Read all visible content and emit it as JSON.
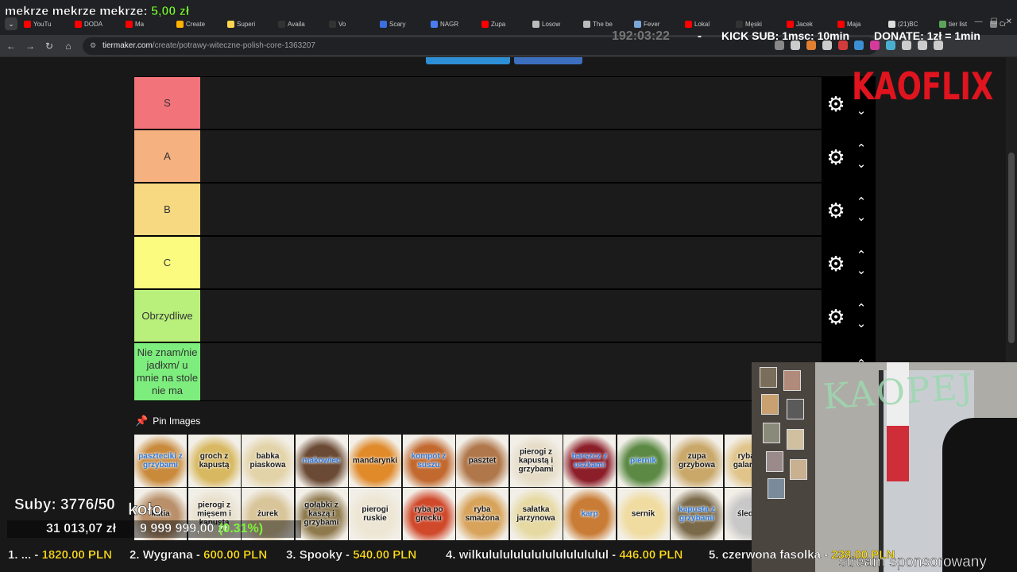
{
  "browser": {
    "tabs": [
      {
        "label": "YouTu",
        "color": "#ff0000"
      },
      {
        "label": "DODA",
        "color": "#ff0000"
      },
      {
        "label": "Ma",
        "color": "#ff0000"
      },
      {
        "label": "Create",
        "color": "#ffb300"
      },
      {
        "label": "Superi",
        "color": "#ffd54f"
      },
      {
        "label": "Availa",
        "color": "#333333"
      },
      {
        "label": "Vo",
        "color": "#333333"
      },
      {
        "label": "Scary",
        "color": "#3b6fe0"
      },
      {
        "label": "NAGR",
        "color": "#4a7cf0"
      },
      {
        "label": "Zupa",
        "color": "#ff0000"
      },
      {
        "label": "Losow",
        "color": "#bbbbbb"
      },
      {
        "label": "The be",
        "color": "#bbbbbb"
      },
      {
        "label": "Fever",
        "color": "#7aa7d9"
      },
      {
        "label": "Lokal",
        "color": "#ff0000"
      },
      {
        "label": "Męski",
        "color": "#333333"
      },
      {
        "label": "Jacek",
        "color": "#ff0000"
      },
      {
        "label": "Maja",
        "color": "#ff0000"
      },
      {
        "label": "(21)BC",
        "color": "#dddddd"
      },
      {
        "label": "tier list",
        "color": "#5aa55a"
      },
      {
        "label": "Cr",
        "color": "#888888"
      }
    ],
    "url_domain": "tiermaker.com",
    "url_path": "/create/potrawy-witeczne-polish-core-1363207",
    "extension_colors": [
      "#888888",
      "#cccccc",
      "#e08030",
      "#cccccc",
      "#d23b3b",
      "#3b8fd2",
      "#d23b9b",
      "#4ab0d0",
      "#cccccc",
      "#cccccc",
      "#cccccc"
    ]
  },
  "tiers": [
    {
      "label": "S",
      "color": "#f2737a"
    },
    {
      "label": "A",
      "color": "#f5b17f"
    },
    {
      "label": "B",
      "color": "#f6d981"
    },
    {
      "label": "C",
      "color": "#fbfb80"
    },
    {
      "label": "Obrzydliwe",
      "color": "#b9f07b"
    },
    {
      "label": "Nie znam/nie jadłxm/ u mnie na stole nie ma",
      "color": "#7dee7d"
    }
  ],
  "pin_images_label": "Pin Images",
  "gallery": [
    {
      "caption": "paszteciki z grzybami",
      "caption_color": "blue",
      "bg": "#c98a3c"
    },
    {
      "caption": "groch z kapustą",
      "caption_color": "dark",
      "bg": "#d8b860"
    },
    {
      "caption": "babka piaskowa",
      "caption_color": "dark",
      "bg": "#e3d3a8"
    },
    {
      "caption": "makowiec",
      "caption_color": "blue",
      "bg": "#6a4a34"
    },
    {
      "caption": "mandarynki",
      "caption_color": "dark",
      "bg": "#e08a2a"
    },
    {
      "caption": "kompot z suszu",
      "caption_color": "blue",
      "bg": "#c2692f"
    },
    {
      "caption": "pasztet",
      "caption_color": "dark",
      "bg": "#b0774a"
    },
    {
      "caption": "pierogi z kapustą i grzybami",
      "caption_color": "dark",
      "bg": "#e6dcc6"
    },
    {
      "caption": "barszcz z uszkami",
      "caption_color": "blue",
      "bg": "#8c1e2a"
    },
    {
      "caption": "piernik",
      "caption_color": "blue",
      "bg": "#5c8a45"
    },
    {
      "caption": "zupa grzybowa",
      "caption_color": "dark",
      "bg": "#c9a86a"
    },
    {
      "caption": "ryba w galarecie",
      "caption_color": "dark",
      "bg": "#e0c48a"
    },
    {
      "caption": "kutia",
      "caption_color": "dark",
      "bg": "#b9906a"
    },
    {
      "caption": "pierogi z mięsem i kapustą",
      "caption_color": "dark",
      "bg": "#e8e0cc"
    },
    {
      "caption": "żurek",
      "caption_color": "dark",
      "bg": "#d9c59a"
    },
    {
      "caption": "gołąbki z kaszą i grzybami",
      "caption_color": "dark",
      "bg": "#8f7a4e"
    },
    {
      "caption": "pierogi ruskie",
      "caption_color": "dark",
      "bg": "#ede6d4"
    },
    {
      "caption": "ryba po grecku",
      "caption_color": "dark",
      "bg": "#d0492b"
    },
    {
      "caption": "ryba smażona",
      "caption_color": "dark",
      "bg": "#d8a35a"
    },
    {
      "caption": "sałatka jarzynowa",
      "caption_color": "dark",
      "bg": "#e6d9a2"
    },
    {
      "caption": "karp",
      "caption_color": "blue",
      "bg": "#c97c35"
    },
    {
      "caption": "sernik",
      "caption_color": "dark",
      "bg": "#f0dca0"
    },
    {
      "caption": "kapusta z grzybami",
      "caption_color": "blue",
      "bg": "#7b6a4a"
    },
    {
      "caption": "śledzie",
      "caption_color": "dark",
      "bg": "#c8c8c8"
    }
  ],
  "overlay": {
    "title_prefix": "mekrze mekrze mekrze:",
    "title_amount": "5,00 zł",
    "timer": "192:03:22",
    "timer_sep": "-",
    "kick_sub": "KICK SUB: 1msc: 10min",
    "donate": "DONATE: 1zł = 1min",
    "logo": "KAOFLIX",
    "neon_sign": "KAOPEJ",
    "suby": "Suby: 3776/50",
    "kolo": "koło",
    "goal_current": "31 013,07 zł",
    "goal_target": "9 999 999,00 zł",
    "goal_percent": "(0.31%)",
    "leaderboard": [
      {
        "rank": "1.",
        "name": "...",
        "amount": "1820.00 PLN"
      },
      {
        "rank": "2.",
        "name": "Wygrana",
        "amount": "600.00 PLN"
      },
      {
        "rank": "3.",
        "name": "Spooky",
        "amount": "540.00 PLN"
      },
      {
        "rank": "4.",
        "name": "wilkulululululululululululul",
        "amount": "446.00 PLN"
      },
      {
        "rank": "5.",
        "name": "czerwona fasolka",
        "amount": "238.00 PLN"
      }
    ],
    "sponsor": "stream sponsorowany"
  },
  "colors": {
    "accent_green": "#7cf43b",
    "accent_yellow": "#ffdf1f",
    "brand_red": "#e0141e",
    "top_button_blue": "#2d8fd5",
    "top_button_blue2": "#3d6fbf"
  }
}
